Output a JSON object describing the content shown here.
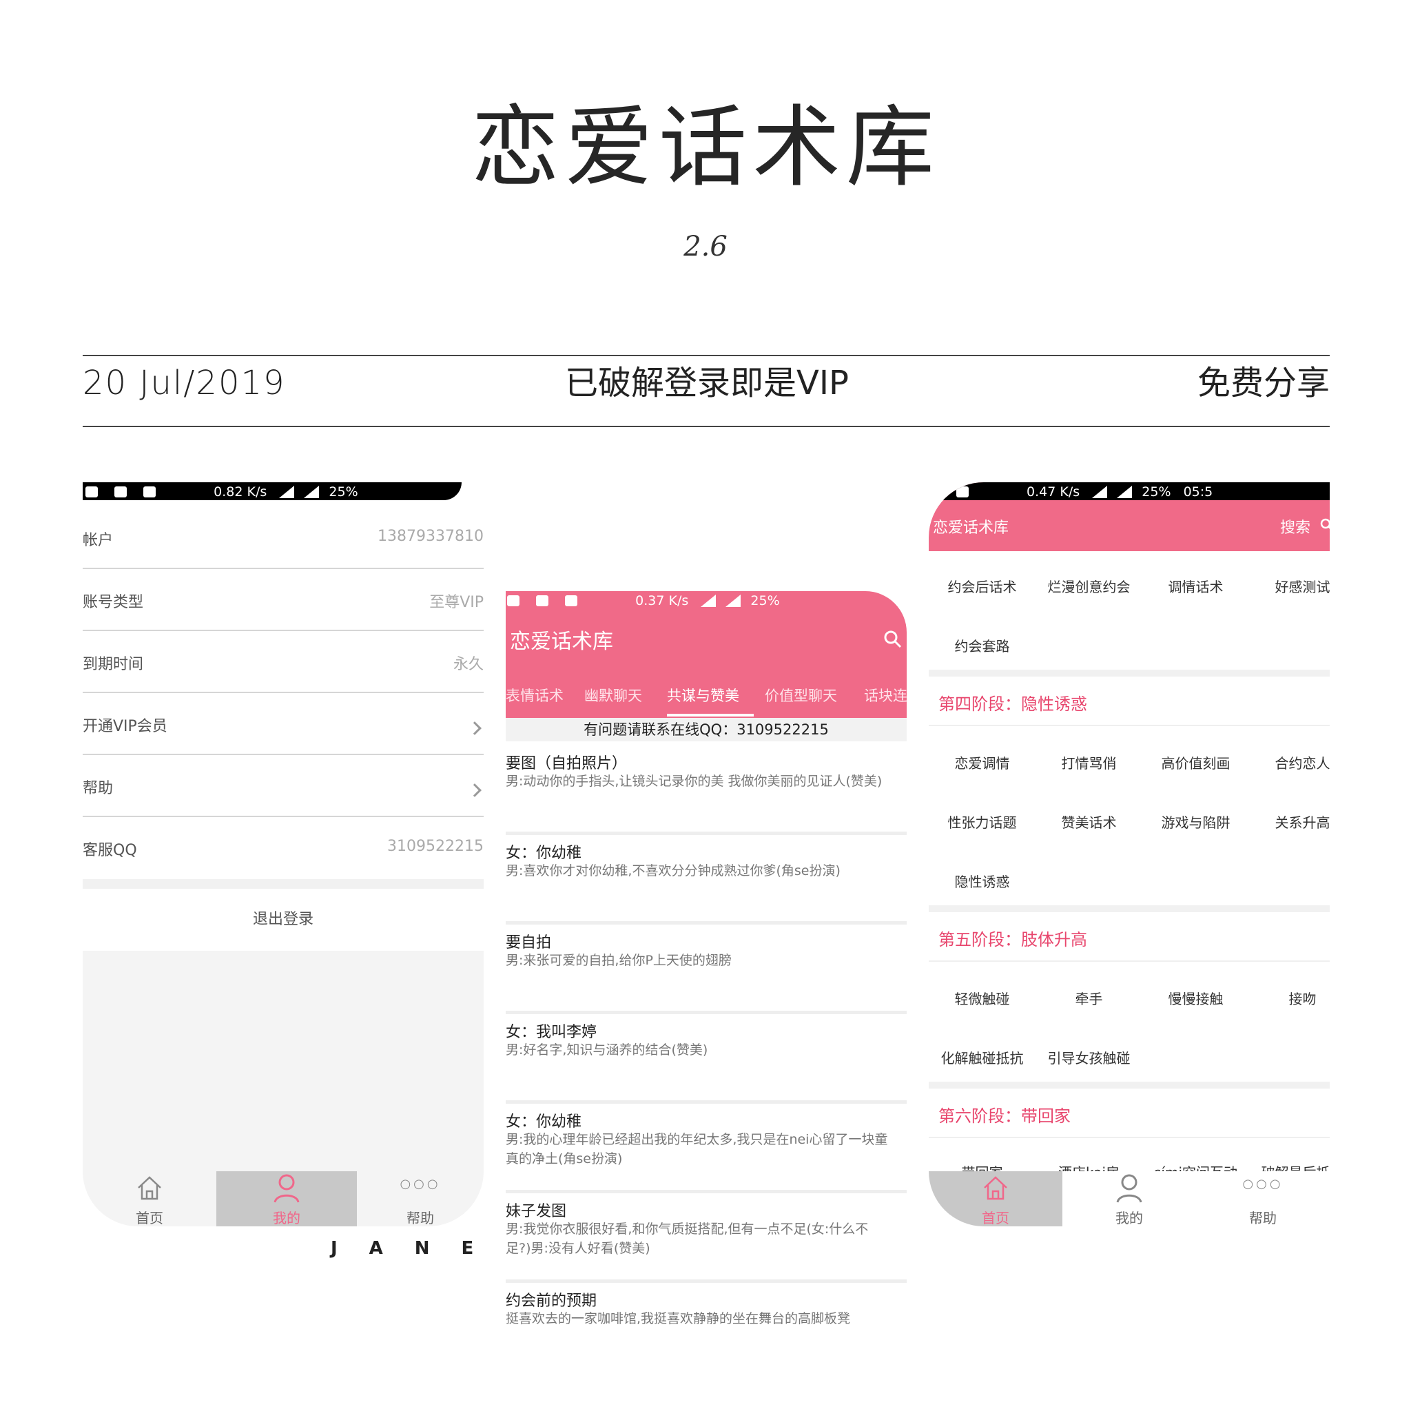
{
  "header": {
    "title": "恋爱话术库",
    "issue": "2.6",
    "date": "20 Jul/2019",
    "tagline": "已破解登录即是VIP",
    "right_text": "免费分享",
    "footer_mark": "JANE"
  },
  "screen_account": {
    "status_speed": "0.82 K/s",
    "status_battery": "25%",
    "rows": [
      {
        "label": "帐户",
        "value": "13879337810"
      },
      {
        "label": "账号类型",
        "value": "至尊VIP"
      },
      {
        "label": "到期时间",
        "value": "永久"
      },
      {
        "label": "开通VIP会员",
        "value": ""
      },
      {
        "label": "帮助",
        "value": ""
      },
      {
        "label": "客服QQ",
        "value": "3109522215"
      }
    ],
    "logout": "退出登录",
    "tabs": [
      "首页",
      "我的",
      "帮助"
    ]
  },
  "screen_chat": {
    "status_speed": "0.37 K/s",
    "status_battery": "25%",
    "app_title": "恋爱话术库",
    "categories": [
      "表情话术",
      "幽默聊天",
      "共谋与赞美",
      "价值型聊天",
      "话块连"
    ],
    "active_category": "共谋与赞美",
    "notice": "有问题请联系在线QQ：3109522215",
    "items": [
      {
        "title": "要图（自拍照片）",
        "body": "男:动动你的手指头,让镜头记录你的美 我做你美丽的见证人(赞美)"
      },
      {
        "title": "女：你幼稚",
        "body": "男:喜欢你才对你幼稚,不喜欢分分钟成熟过你爹(角se扮演)"
      },
      {
        "title": "要自拍",
        "body": "男:来张可爱的自拍,给你P上天使的翅膀"
      },
      {
        "title": "女：我叫李婷",
        "body": "男:好名字,知识与涵养的结合(赞美)"
      },
      {
        "title": "女：你幼稚",
        "body": "男:我的心理年龄已经超出我的年纪太多,我只是在nei心留了一块童真的净土(角se扮演)"
      },
      {
        "title": "妹子发图",
        "body": "男:我觉你衣服很好看,和你气质挺搭配,但有一点不足(女:什么不足?)男:没有人好看(赞美)"
      },
      {
        "title": "约会前的预期",
        "body": "挺喜欢去的一家咖啡馆,我挺喜欢静静的坐在舞台的高脚板凳"
      }
    ]
  },
  "screen_home": {
    "status_speed": "0.47 K/s",
    "status_battery": "25%",
    "status_time": "05:5",
    "app_title": "恋爱话术库",
    "search_label": "搜索",
    "top_items": [
      "约会后话术",
      "烂漫创意约会",
      "调情话术",
      "好感测试",
      "约会套路"
    ],
    "stages": [
      {
        "title": "第四阶段：隐性诱惑",
        "items": [
          "恋爱调情",
          "打情骂俏",
          "高价值刻画",
          "合约恋人",
          "性张力话题",
          "赞美话术",
          "游戏与陷阱",
          "关系升高",
          "隐性诱惑"
        ]
      },
      {
        "title": "第五阶段：肢体升高",
        "items": [
          "轻微触碰",
          "牵手",
          "慢慢接触",
          "接吻",
          "化解触碰抵抗",
          "引导女孩触碰"
        ]
      },
      {
        "title": "第六阶段：带回家",
        "items": [
          "带回家",
          "酒店kai房",
          "sími空间互动",
          "破解最后抵抗"
        ]
      }
    ],
    "tabs": [
      "首页",
      "我的",
      "帮助"
    ]
  },
  "colors": {
    "accent": "#f06a88",
    "stage_text": "#e8476e",
    "active_tab_bg": "#c8c8c8"
  }
}
